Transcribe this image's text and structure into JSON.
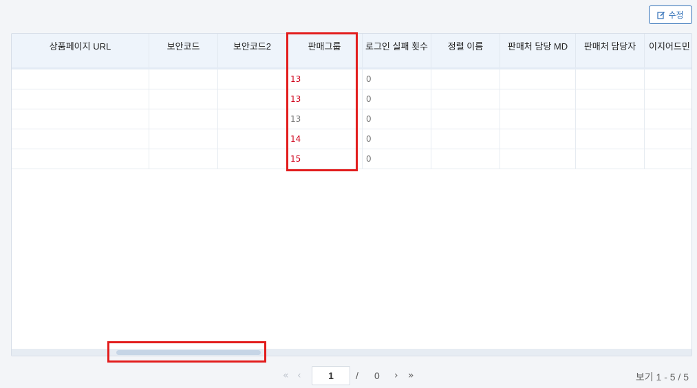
{
  "toolbar": {
    "edit_label": "수정",
    "edit_icon": "edit-icon"
  },
  "table": {
    "columns": [
      "상품페이지 URL",
      "보안코드",
      "보안코드2",
      "판매그룹",
      "로그인 실패 횟수",
      "정렬 이름",
      "판매처 담당 MD",
      "판매처 담당자",
      "이지어드민"
    ],
    "rows": [
      {
        "sales_group": "13",
        "sales_group_red": true,
        "login_fail": "0"
      },
      {
        "sales_group": "13",
        "sales_group_red": true,
        "login_fail": "0"
      },
      {
        "sales_group": "13",
        "sales_group_red": false,
        "login_fail": "0"
      },
      {
        "sales_group": "14",
        "sales_group_red": true,
        "login_fail": "0"
      },
      {
        "sales_group": "15",
        "sales_group_red": true,
        "login_fail": "0"
      }
    ]
  },
  "pagination": {
    "first_icon": "double-chevron-left-icon",
    "prev_icon": "chevron-left-icon",
    "next_icon": "chevron-right-icon",
    "last_icon": "double-chevron-right-icon",
    "current_page": "1",
    "separator": "/",
    "total_pages": "0",
    "view_info": "보기 1 - 5 / 5"
  },
  "colors": {
    "highlight": "#e21c1c",
    "accent": "#2f6fb7",
    "red_value": "#d0021b"
  }
}
